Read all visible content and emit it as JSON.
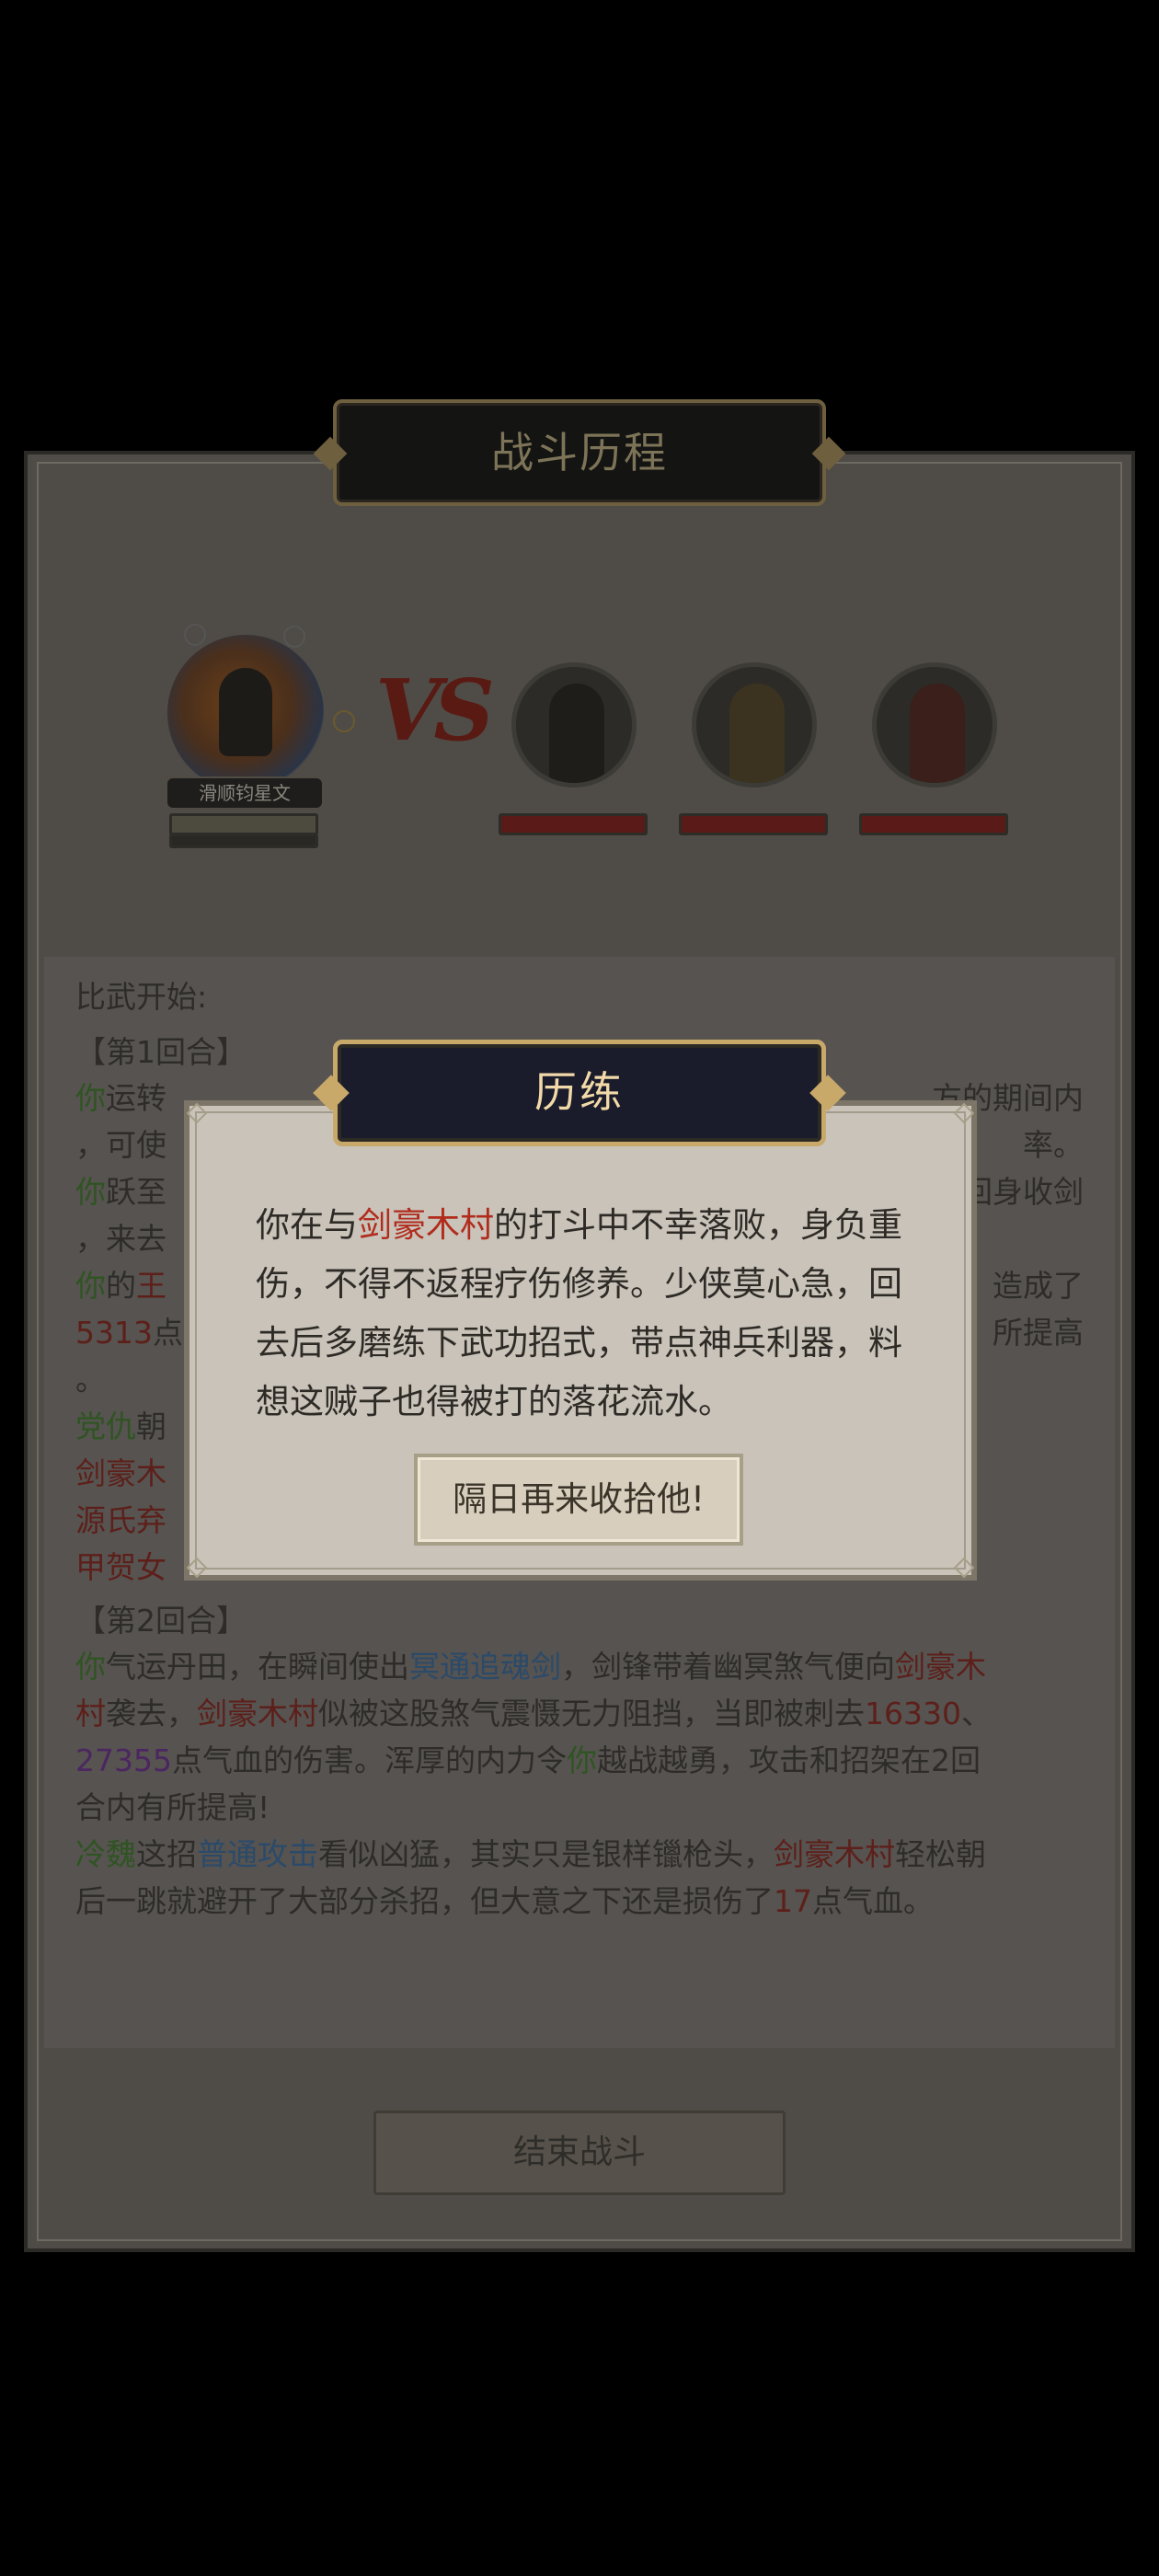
{
  "battle": {
    "title": "战斗历程",
    "player_name": "滑顺钧星文",
    "log_intro": "比武开始:",
    "round1_label": "【第1回合】",
    "round1": [
      {
        "parts": [
          {
            "t": "你",
            "c": "g"
          },
          {
            "t": "运转",
            "c": ""
          },
          {
            "t": "",
            "c": ""
          }
        ],
        "tail": "方的期间内"
      },
      {
        "parts": [
          {
            "t": "，可使",
            "c": ""
          }
        ],
        "tail": "率。"
      },
      {
        "parts": [
          {
            "t": "你",
            "c": "g"
          },
          {
            "t": "跃至",
            "c": ""
          }
        ],
        "tail": "回身收剑"
      },
      {
        "parts": [
          {
            "t": "，来去",
            "c": ""
          }
        ],
        "tail": ""
      },
      {
        "parts": [
          {
            "t": "你",
            "c": "g"
          },
          {
            "t": "的",
            "c": ""
          },
          {
            "t": "王",
            "c": "r"
          }
        ],
        "tail": "造成了"
      },
      {
        "parts": [
          {
            "t": "5313",
            "c": "r"
          },
          {
            "t": "点",
            "c": ""
          }
        ],
        "tail": "所提高"
      },
      {
        "parts": [
          {
            "t": "。",
            "c": ""
          }
        ],
        "tail": ""
      },
      {
        "parts": [
          {
            "t": "党仇",
            "c": "g"
          },
          {
            "t": "朝",
            "c": ""
          }
        ],
        "tail": ""
      },
      {
        "parts": [
          {
            "t": "剑豪木",
            "c": "r"
          }
        ],
        "tail": ""
      },
      {
        "parts": [
          {
            "t": "源氏弃",
            "c": "r"
          }
        ],
        "tail": ""
      },
      {
        "parts": [
          {
            "t": "甲贺女",
            "c": "r"
          }
        ],
        "tail": ""
      }
    ],
    "round2_label": "【第2回合】",
    "round2": [
      [
        {
          "t": "你",
          "c": "g"
        },
        {
          "t": "气运丹田，在瞬间使出",
          "c": ""
        },
        {
          "t": "冥通追魂剑",
          "c": "b"
        },
        {
          "t": "，剑锋带着幽冥煞气便向",
          "c": ""
        },
        {
          "t": "剑豪木",
          "c": "r"
        }
      ],
      [
        {
          "t": "村",
          "c": "r"
        },
        {
          "t": "袭去，",
          "c": ""
        },
        {
          "t": "剑豪木村",
          "c": "r"
        },
        {
          "t": "似被这股煞气震慑无力阻挡，当即被刺去",
          "c": ""
        },
        {
          "t": "16330",
          "c": "r"
        },
        {
          "t": "、",
          "c": ""
        }
      ],
      [
        {
          "t": "27355",
          "c": "p"
        },
        {
          "t": "点气血的伤害。浑厚的内力令",
          "c": ""
        },
        {
          "t": "你",
          "c": "g"
        },
        {
          "t": "越战越勇，攻击和招架在2回",
          "c": ""
        }
      ],
      [
        {
          "t": "合内有所提高!",
          "c": ""
        }
      ],
      [
        {
          "t": "冷魏",
          "c": "g"
        },
        {
          "t": "这招",
          "c": ""
        },
        {
          "t": "普通攻击",
          "c": "b"
        },
        {
          "t": "看似凶猛，其实只是银样镴枪头，",
          "c": ""
        },
        {
          "t": "剑豪木村",
          "c": "r"
        },
        {
          "t": "轻松朝",
          "c": ""
        }
      ],
      [
        {
          "t": "后一跳就避开了大部分杀招，但大意之下还是损伤了",
          "c": ""
        },
        {
          "t": "17",
          "c": "r"
        },
        {
          "t": "点气血。",
          "c": ""
        }
      ]
    ],
    "end_button": "结束战斗"
  },
  "modal": {
    "title": "历练",
    "text_before": "你在与",
    "enemy_name": "剑豪木村",
    "text_after": "的打斗中不幸落败，身负重伤，不得不返程疗伤修养。少侠莫心急，回去后多磨练下武功招式，带点神兵利器，料想这贼子也得被打的落花流水。",
    "button": "隔日再来收拾他!"
  },
  "colors": {
    "accent_gold": "#c8a96a",
    "enemy_red": "#b12c1d"
  }
}
